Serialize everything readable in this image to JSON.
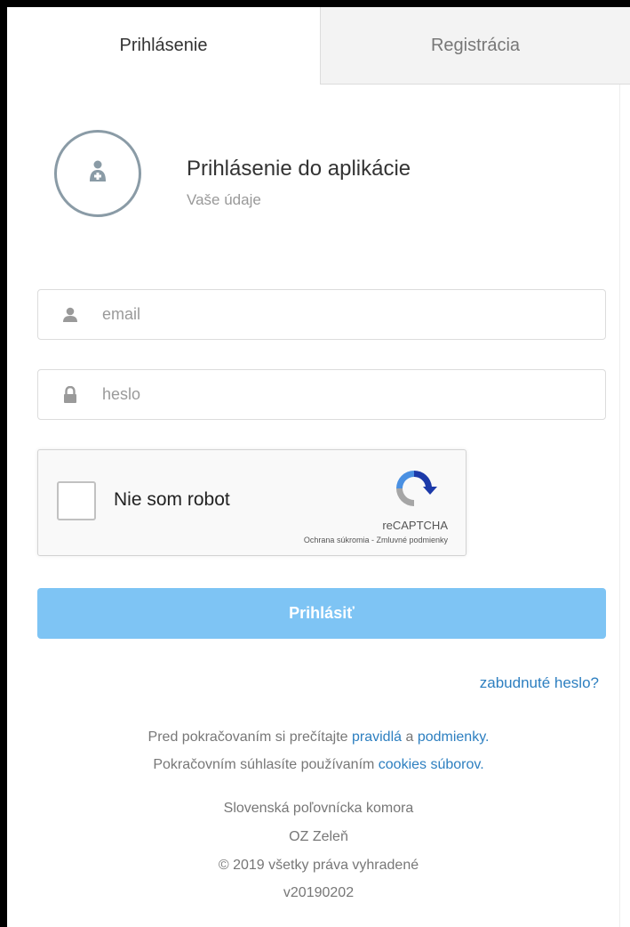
{
  "tabs": {
    "login": "Prihlásenie",
    "register": "Registrácia"
  },
  "header": {
    "title": "Prihlásenie do aplikácie",
    "subtitle": "Vaše údaje",
    "avatar_icon": "user-plus-icon"
  },
  "form": {
    "email_placeholder": "email",
    "email_value": "",
    "password_placeholder": "heslo",
    "password_value": "",
    "email_icon": "user-icon",
    "password_icon": "lock-icon"
  },
  "captcha": {
    "label": "Nie som robot",
    "brand": "reCAPTCHA",
    "privacy": "Ochrana súkromia",
    "separator": " - ",
    "terms": "Zmluvné podmienky"
  },
  "submit_label": "Prihlásiť",
  "forgot_password": "zabudnuté heslo?",
  "info": {
    "line1_prefix": "Pred pokračovaním si prečítajte ",
    "rules_link": "pravidlá",
    "and": " a ",
    "conditions_link": "podmienky.",
    "line2_prefix": "Pokračovním súhlasíte používaním ",
    "cookies_link": "cookies súborov."
  },
  "footer": {
    "org": "Slovenská poľovnícka komora",
    "unit": "OZ Zeleň",
    "copyright": "© 2019 všetky práva vyhradené",
    "version": "v20190202"
  },
  "colors": {
    "accent": "#7ec4f4",
    "link": "#2d7fc0",
    "avatar_ring": "#8a9ba6"
  }
}
